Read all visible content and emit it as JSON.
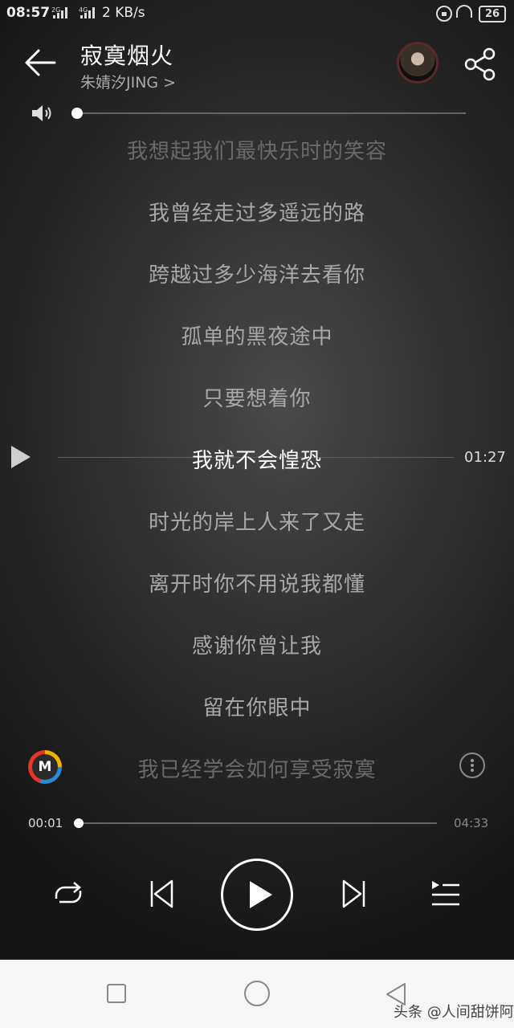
{
  "status_bar": {
    "time": "08:57",
    "signal1": "2G",
    "signal2": "4G",
    "speed": "2 KB/s",
    "battery": "26"
  },
  "header": {
    "title": "寂寞烟火",
    "artist": "朱婧汐JING >"
  },
  "volume": {
    "level": 0.0
  },
  "lyrics": [
    "我想起我们最快乐时的笑容",
    "我曾经走过多遥远的路",
    "跨越过多少海洋去看你",
    "孤单的黑夜途中",
    "只要想着你",
    "我就不会惶恐",
    "时光的岸上人来了又走",
    "离开时你不用说我都懂",
    "感谢你曾让我",
    "留在你眼中",
    "我已经学会如何享受寂寞"
  ],
  "current_lyric_index": 5,
  "seek_time": "01:27",
  "logo_letter": "M",
  "progress": {
    "current": "00:01",
    "total": "04:33",
    "fraction": 0.004
  },
  "icons": {
    "back": "back-arrow-icon",
    "share": "share-icon",
    "volume": "volume-icon",
    "repeat": "repeat-icon",
    "prev": "previous-icon",
    "play": "play-icon",
    "next": "next-icon",
    "playlist": "playlist-icon"
  },
  "nav": {
    "watermark": "头条 @人间甜饼阿"
  }
}
